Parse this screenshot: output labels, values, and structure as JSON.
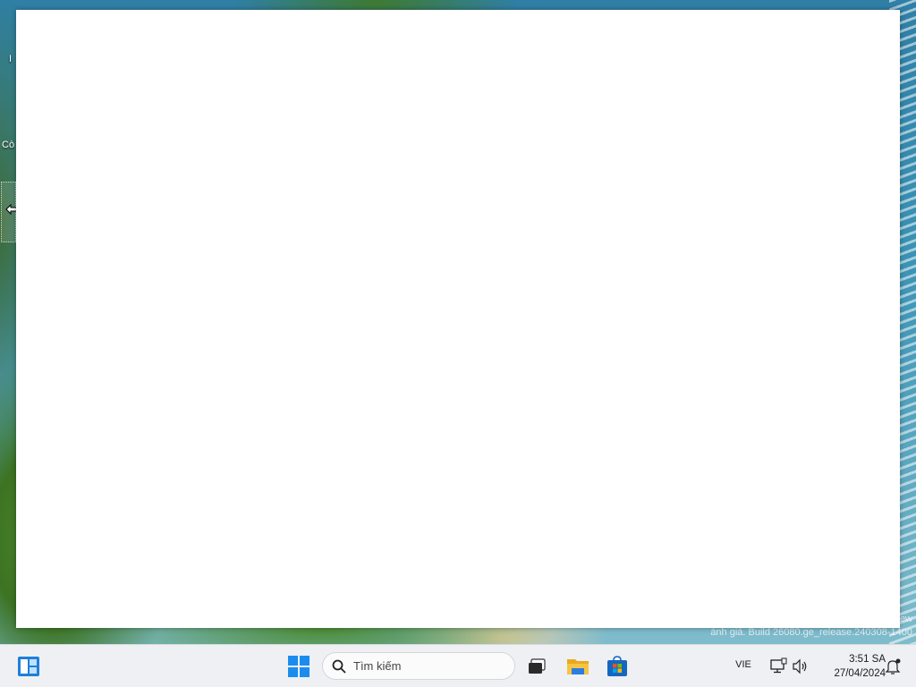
{
  "desktop": {
    "icon_label_partial": "Cò",
    "icon_label_top_partial": "I",
    "watermark": {
      "line1": "ew",
      "line2": "ánh giá. Build 26080.ge_release.240308-1400"
    }
  },
  "window": {
    "state": "blank"
  },
  "taskbar": {
    "search_placeholder": "Tìm kiếm",
    "language": "VIE",
    "time": "3:51 SA",
    "date": "27/04/2024",
    "icons": {
      "widgets": "widgets-icon",
      "start": "windows-start-icon",
      "search": "search-icon",
      "task_view": "task-view-icon",
      "file_explorer": "file-explorer-icon",
      "store": "microsoft-store-icon",
      "network": "network-icon",
      "volume": "volume-icon",
      "notifications": "notifications-icon"
    },
    "colors": {
      "start_blue": "#1a8cf0",
      "folder_yellow": "#f6c445",
      "store_blue": "#1566c0"
    }
  }
}
